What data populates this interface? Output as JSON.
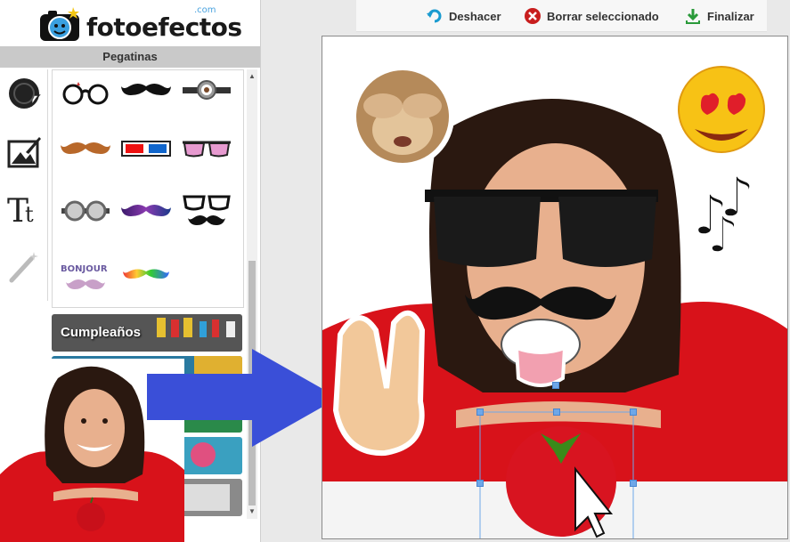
{
  "brand": {
    "name": "fotoefectos",
    "com": ".com"
  },
  "panel": {
    "section_title": "Pegatinas"
  },
  "tools": [
    {
      "name": "stickers-tool",
      "icon": "sticker-icon"
    },
    {
      "name": "backgrounds-tool",
      "icon": "paint-image-icon"
    },
    {
      "name": "text-tool",
      "icon": "text-icon"
    },
    {
      "name": "effects-tool",
      "icon": "magic-wand-icon"
    }
  ],
  "stickers": [
    {
      "name": "glasses-round",
      "icon": "round-glasses-icon"
    },
    {
      "name": "mustache-black",
      "icon": "mustache-icon"
    },
    {
      "name": "minion-goggles",
      "icon": "goggles-icon"
    },
    {
      "name": "mustache-brown",
      "icon": "mustache-icon"
    },
    {
      "name": "3d-glasses",
      "icon": "3d-glasses-icon"
    },
    {
      "name": "pink-glasses",
      "icon": "sunglasses-icon"
    },
    {
      "name": "steampunk-goggles",
      "icon": "goggles-icon"
    },
    {
      "name": "galaxy-mustache",
      "icon": "mustache-icon"
    },
    {
      "name": "glasses-mustache",
      "icon": "glasses-mustache-icon"
    },
    {
      "name": "bonjour-text",
      "label": "BONJOUR"
    },
    {
      "name": "rainbow-mustache",
      "icon": "mustache-icon"
    }
  ],
  "categories": [
    {
      "label": "Cumpleaños"
    }
  ],
  "toolbar": {
    "undo_label": "Deshacer",
    "delete_label": "Borrar seleccionado",
    "finish_label": "Finalizar"
  },
  "colors": {
    "accent": "#3a4fd8",
    "undo": "#1a9bd0",
    "delete": "#c81e1e",
    "finish": "#2a9a3a",
    "shirt": "#d8121a"
  }
}
